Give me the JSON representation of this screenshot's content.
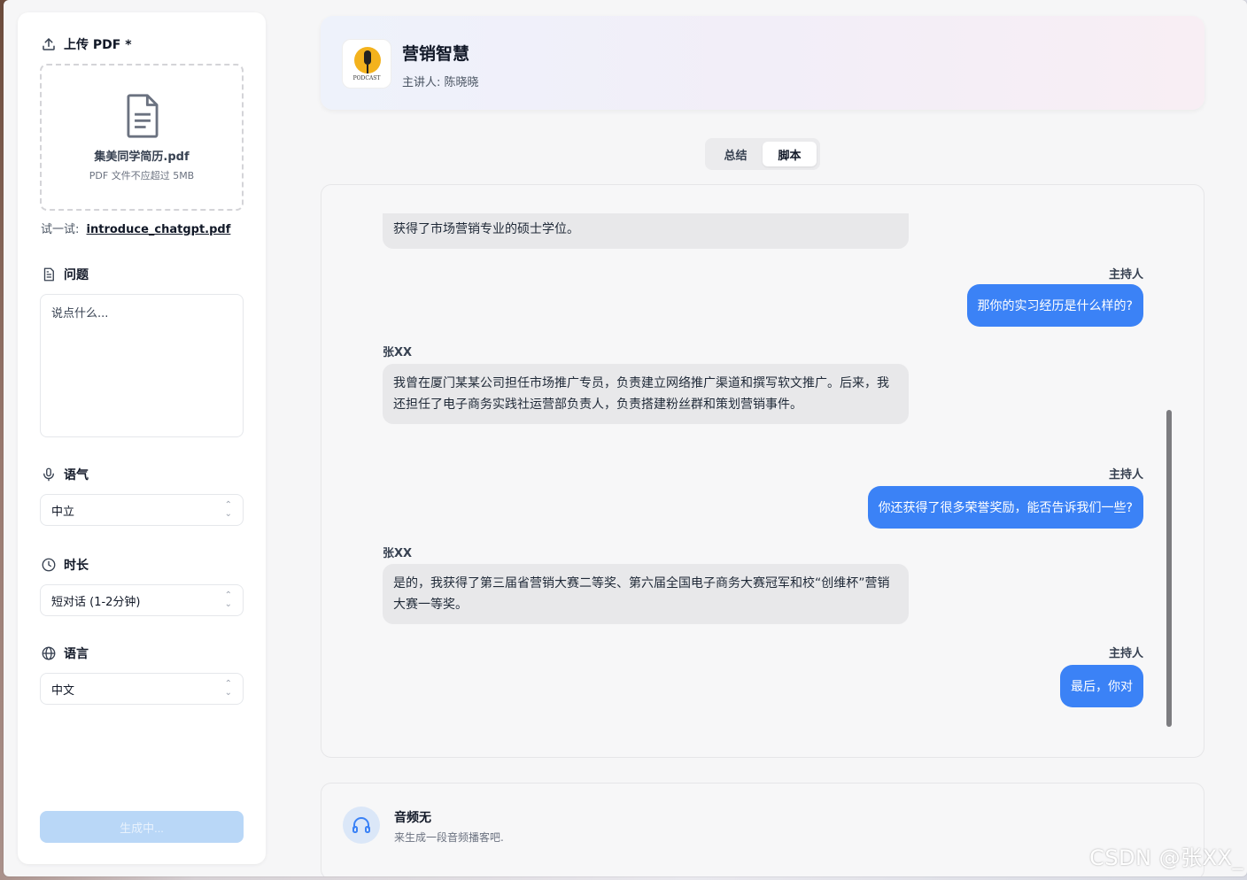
{
  "sidebar": {
    "upload_label": "上传 PDF *",
    "file_name": "集美同学简历.pdf",
    "file_hint": "PDF 文件不应超过 5MB",
    "try_prefix": "试一试:",
    "try_link": "introduce_chatgpt.pdf",
    "question_label": "问题",
    "question_placeholder": "说点什么...",
    "tone_label": "语气",
    "tone_value": "中立",
    "duration_label": "时长",
    "duration_value": "短对话 (1-2分钟)",
    "language_label": "语言",
    "language_value": "中文",
    "generate_label": "生成中..."
  },
  "header": {
    "logo_text": "PODCAST",
    "title": "营销智慧",
    "host": "主讲人: 陈晓晓"
  },
  "tabs": [
    {
      "label": "总结",
      "active": false
    },
    {
      "label": "脚本",
      "active": true
    }
  ],
  "chat": {
    "messages": [
      {
        "role": "guest",
        "speaker": "",
        "text": "获得了市场营销专业的硕士学位。"
      },
      {
        "role": "host",
        "speaker": "主持人",
        "text": "那你的实习经历是什么样的?"
      },
      {
        "role": "guest",
        "speaker": "张XX",
        "text": "我曾在厦门某某公司担任市场推广专员，负责建立网络推广渠道和撰写软文推广。后来，我还担任了电子商务实践社运营部负责人，负责搭建粉丝群和策划营销事件。"
      },
      {
        "role": "host",
        "speaker": "主持人",
        "text": "你还获得了很多荣誉奖励，能否告诉我们一些?"
      },
      {
        "role": "guest",
        "speaker": "张XX",
        "text": "是的，我获得了第三届省营销大赛二等奖、第六届全国电子商务大赛冠军和校“创维杯”营销大赛一等奖。"
      },
      {
        "role": "host",
        "speaker": "主持人",
        "text": "最后，你对"
      }
    ]
  },
  "audio": {
    "title": "音频无",
    "subtitle": "来生成一段音频播客吧."
  },
  "watermark": "CSDN @张XX_",
  "colors": {
    "accent": "#3b82f6",
    "generate_disabled": "#b9d7f7",
    "logo_yellow": "#f3b21d"
  }
}
